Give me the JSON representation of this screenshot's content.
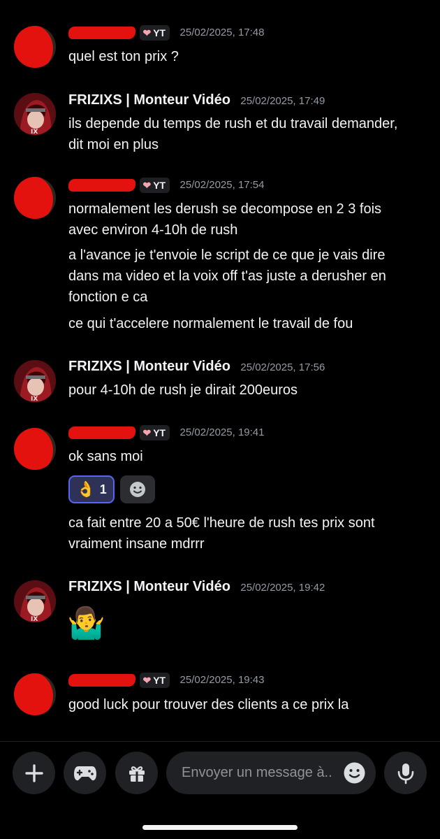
{
  "messages": [
    {
      "author_badge": "YT",
      "timestamp": "25/02/2025, 17:48",
      "lines": [
        "quel est ton prix ?"
      ]
    },
    {
      "author": "FRIZIXS | Monteur Vidéo",
      "timestamp": "25/02/2025, 17:49",
      "lines": [
        "ils depende du temps de rush et du travail demander,",
        "dit moi en plus"
      ]
    },
    {
      "author_badge": "YT",
      "timestamp": "25/02/2025, 17:54",
      "paragraphs": [
        [
          "normalement les derush se decompose en 2 3 fois",
          "avec environ 4-10h de rush"
        ],
        [
          "a l'avance je t'envoie le script de ce que je vais dire",
          "dans ma video et la voix off t'as juste a derusher en",
          "fonction e ca"
        ],
        [
          "ce qui t'accelere normalement le travail de fou"
        ]
      ]
    },
    {
      "author": "FRIZIXS | Monteur Vidéo",
      "timestamp": "25/02/2025, 17:56",
      "lines": [
        "pour 4-10h de rush je dirait 200euros"
      ]
    },
    {
      "author_badge": "YT",
      "timestamp": "25/02/2025, 19:41",
      "lines": [
        "ok sans moi"
      ],
      "reaction": {
        "emoji": "👌",
        "count": "1",
        "add_icon": "add-reaction-smiley-icon"
      },
      "followup": [
        "ca fait entre 20 a 50€ l'heure de rush tes prix sont",
        "vraiment insane mdrrr"
      ]
    },
    {
      "author": "FRIZIXS | Monteur Vidéo",
      "timestamp": "25/02/2025, 19:42",
      "emoji": "🤷‍♂️"
    },
    {
      "author_badge": "YT",
      "timestamp": "25/02/2025, 19:43",
      "lines": [
        "good luck pour trouver des clients a ce prix la"
      ]
    }
  ],
  "composer": {
    "placeholder": "Envoyer un message à..",
    "buttons": [
      "plus-icon",
      "gamepad-icon",
      "gift-icon",
      "microphone-icon"
    ]
  },
  "colors": {
    "background": "#000000",
    "redaction": "#e4120f",
    "accent": "#5865f2",
    "timestamp": "#949ba4"
  }
}
